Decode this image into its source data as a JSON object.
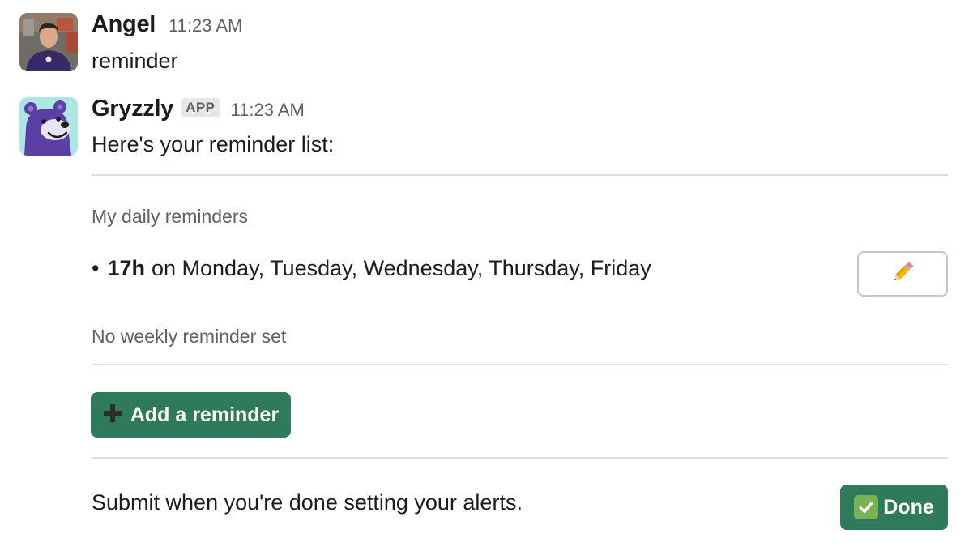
{
  "messages": [
    {
      "sender": "Angel",
      "time": "11:23 AM",
      "text": "reminder"
    },
    {
      "sender": "Gryzzly",
      "badge": "APP",
      "time": "11:23 AM",
      "text": "Here's your reminder list:"
    }
  ],
  "reminders": {
    "daily_heading": "My daily reminders",
    "daily_item": {
      "bullet": "•",
      "time": "17h",
      "days": "on Monday, Tuesday, Wednesday, Thursday, Friday"
    },
    "edit_icon": "pencil-icon",
    "weekly_status": "No weekly reminder set",
    "add_button_label": "Add a reminder",
    "add_icon": "plus-icon"
  },
  "footer": {
    "submit_text": "Submit when you're done setting your alerts.",
    "done_button_label": "Done",
    "done_icon": "check-mark-icon"
  },
  "colors": {
    "button_green": "#2f7a5b",
    "bot_avatar_bg": "#aee6e4",
    "bear_purple": "#5b3fa6"
  }
}
